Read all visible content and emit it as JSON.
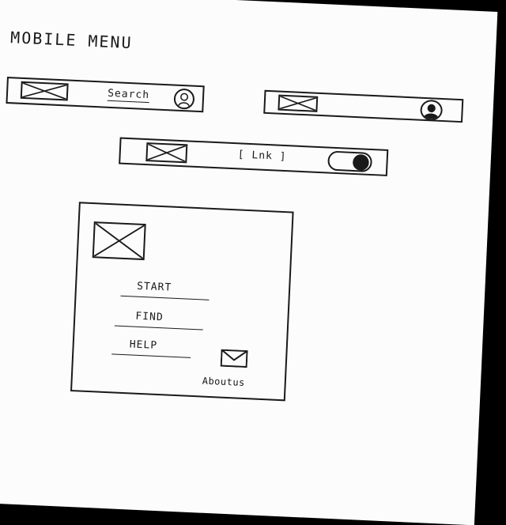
{
  "sketch": {
    "title": "MOBILE MENU",
    "bar1": {
      "image_icon": "image-placeholder-icon",
      "search_label": "Search",
      "user_icon": "user-outline-icon"
    },
    "bar2": {
      "image_icon": "image-placeholder-icon",
      "user_icon": "user-filled-icon"
    },
    "bar3": {
      "image_icon": "image-placeholder-icon",
      "link_label": "[ Lnk ]",
      "toggle_icon": "toggle-switch-icon"
    },
    "panel": {
      "image_icon": "image-placeholder-icon",
      "items": [
        {
          "label": "START"
        },
        {
          "label": "FIND"
        },
        {
          "label": "HELP"
        }
      ],
      "mail_icon": "envelope-icon",
      "footer_label": "Aboutus"
    }
  }
}
